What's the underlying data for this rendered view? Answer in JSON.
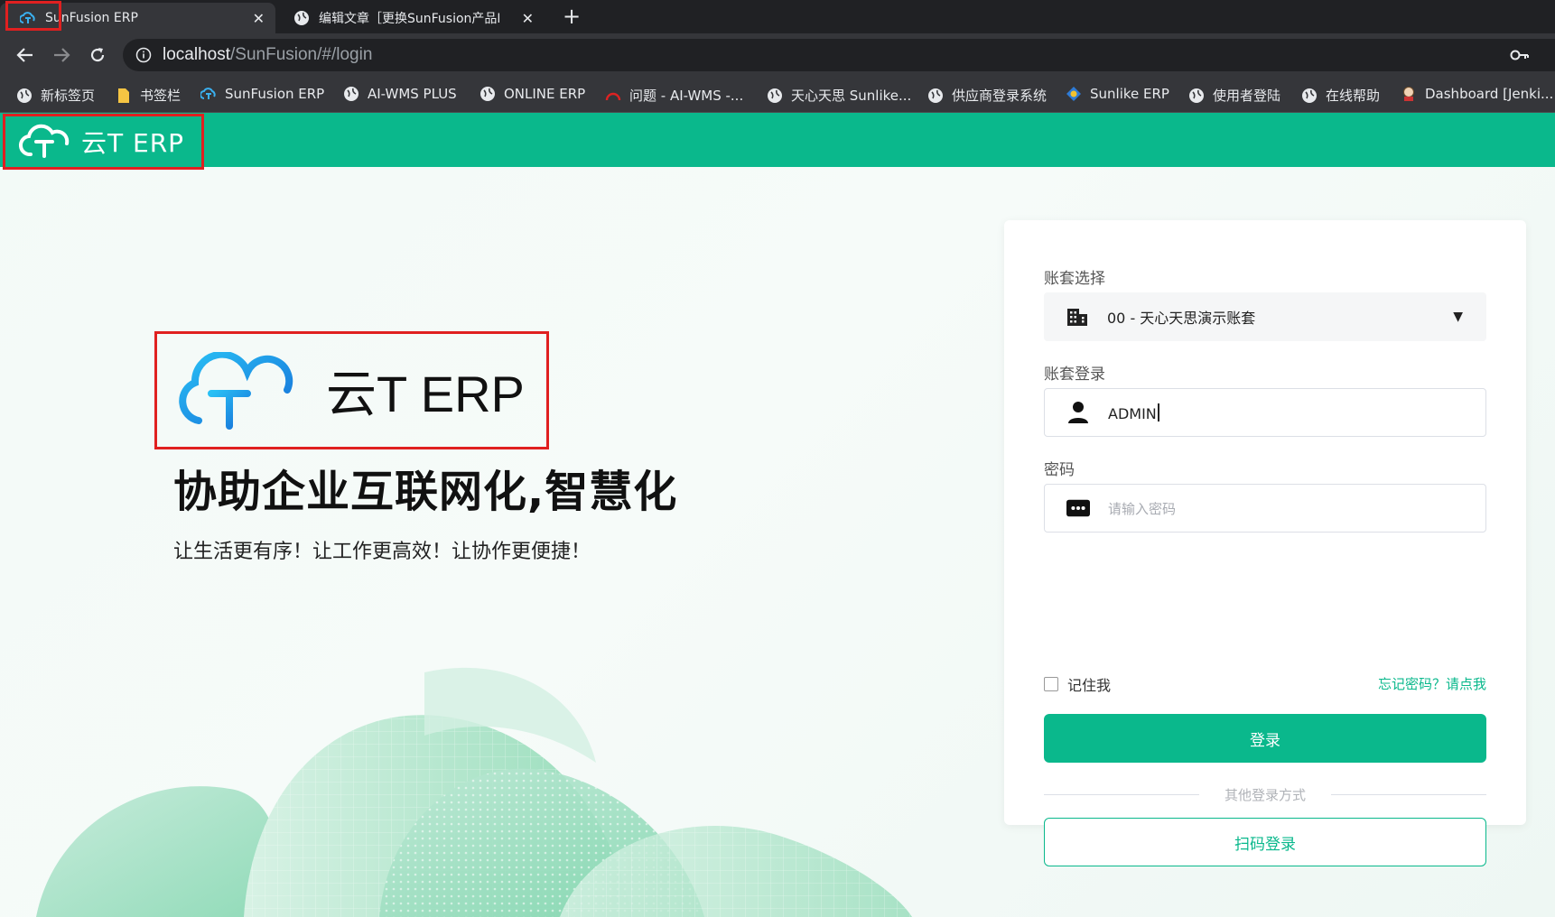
{
  "browser": {
    "tabs": [
      {
        "title": "SunFusion ERP",
        "close": "✕"
      },
      {
        "title": "编辑文章［更换SunFusion产品L",
        "close": "✕"
      }
    ],
    "new_tab": "+",
    "url_host": "localhost",
    "url_path": "/SunFusion/#/login",
    "bookmarks": [
      {
        "label": "新标签页",
        "icon": "globe-icon"
      },
      {
        "label": "书签栏",
        "icon": "folder-icon"
      },
      {
        "label": "SunFusion ERP",
        "icon": "cloud-icon"
      },
      {
        "label": "AI-WMS PLUS",
        "icon": "globe-icon"
      },
      {
        "label": "ONLINE ERP",
        "icon": "globe-icon"
      },
      {
        "label": "问题 - AI-WMS -...",
        "icon": "red-arc-icon"
      },
      {
        "label": "天心天思 Sunlike...",
        "icon": "globe-icon"
      },
      {
        "label": "供应商登录系统",
        "icon": "globe-icon"
      },
      {
        "label": "Sunlike ERP",
        "icon": "sunlike-icon"
      },
      {
        "label": "使用者登陆",
        "icon": "globe-icon"
      },
      {
        "label": "在线帮助",
        "icon": "globe-icon"
      },
      {
        "label": "Dashboard [Jenki...",
        "icon": "jenkins-icon"
      }
    ]
  },
  "header": {
    "brand": "云T ERP"
  },
  "hero": {
    "brand": "云T ERP",
    "title": "协助企业互联网化,智慧化",
    "subtitle": "让生活更有序！让工作更高效！让协作更便捷！"
  },
  "login": {
    "account_set_label": "账套选择",
    "account_set_value": "00 - 天心天思演示账套",
    "account_label": "账套登录",
    "account_value": "ADMIN",
    "password_label": "密码",
    "password_placeholder": "请输入密码",
    "remember_label": "记住我",
    "forgot_link": "忘记密码？请点我",
    "login_button": "登录",
    "other_methods": "其他登录方式",
    "qr_button": "扫码登录"
  },
  "colors": {
    "brand_green": "#0ab88c",
    "highlight_red": "#e02020",
    "logo_blue": "#1a9be8"
  }
}
